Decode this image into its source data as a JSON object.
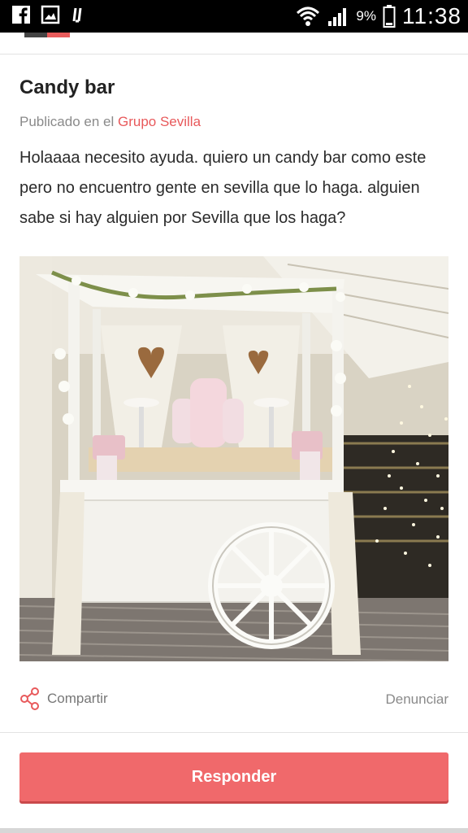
{
  "status_bar": {
    "battery_percent": "9%",
    "time": "11:38",
    "icons": [
      "facebook-icon",
      "gallery-icon",
      "app-icon",
      "wifi-icon",
      "signal-icon",
      "battery-icon"
    ]
  },
  "post": {
    "title": "Candy bar",
    "published_prefix": "Publicado en el ",
    "group_name": "Grupo Sevilla",
    "body": "Holaaaa necesito ayuda. quiero un candy bar como este pero no encuentro gente en sevilla que lo haga. alguien sabe si hay alguien por Sevilla que los haga?",
    "image_icon": "candy-cart-photo"
  },
  "actions": {
    "share_label": "Compartir",
    "share_icon": "share-icon",
    "report_label": "Denunciar"
  },
  "reply": {
    "label": "Responder"
  },
  "colors": {
    "accent": "#e8595b",
    "button": "#f0696b"
  }
}
